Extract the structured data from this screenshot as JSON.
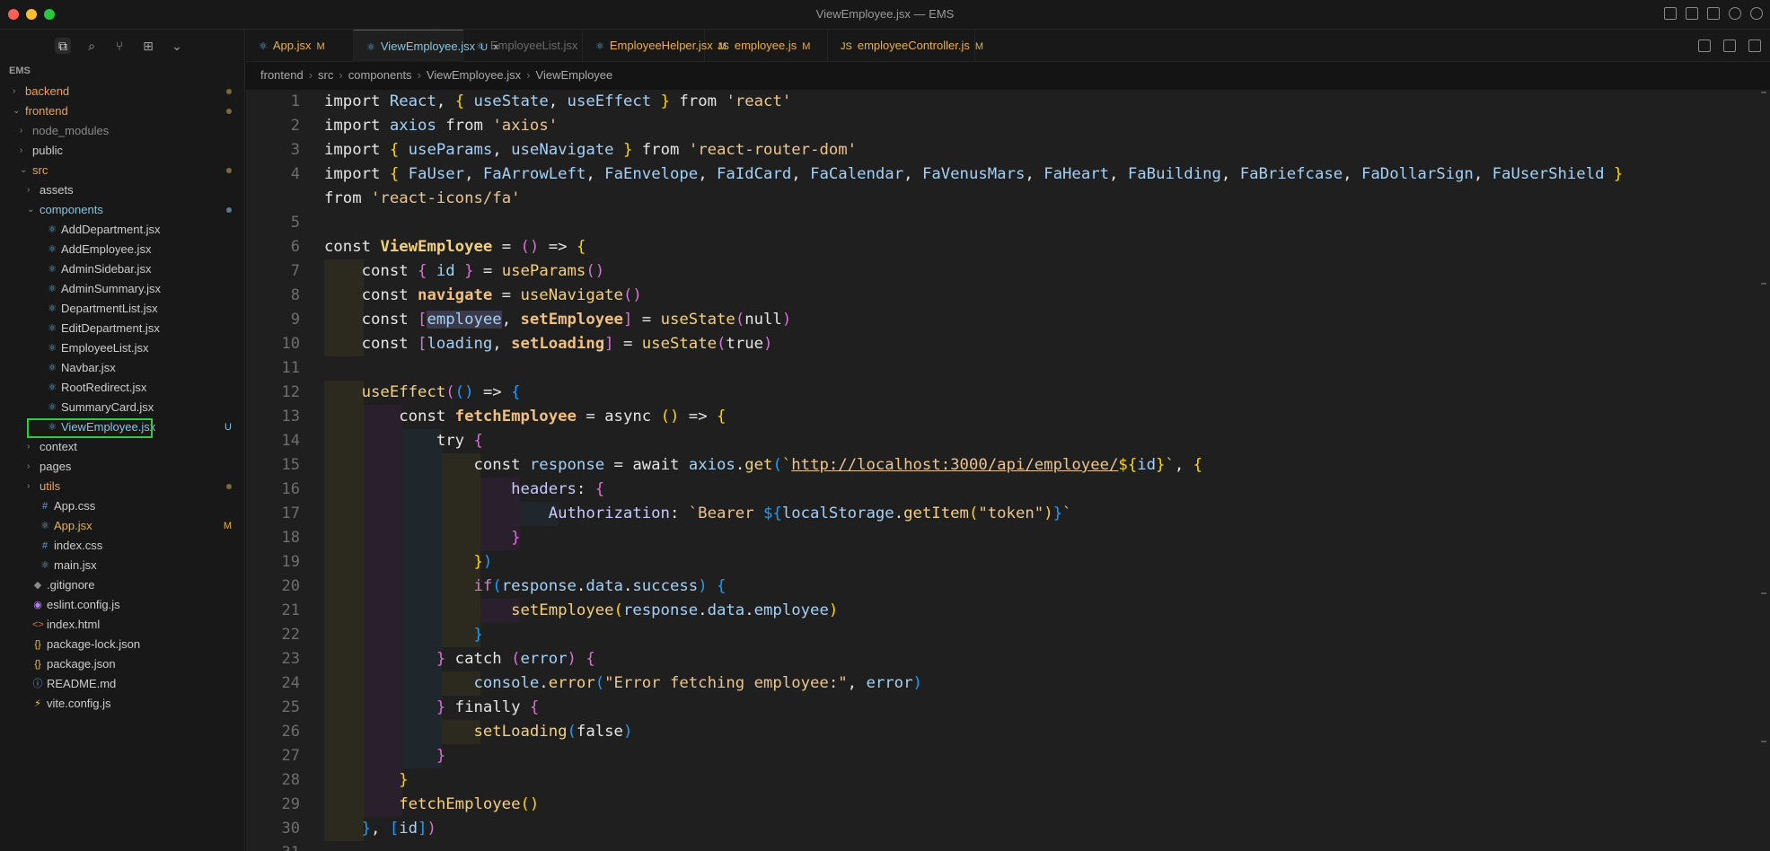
{
  "window": {
    "title": "ViewEmployee.jsx — EMS"
  },
  "sidebar": {
    "project_label": "EMS",
    "tree": [
      {
        "name": "backend",
        "type": "folder",
        "depth": 0,
        "open": false,
        "color": "#f0a050",
        "dot": true
      },
      {
        "name": "frontend",
        "type": "folder",
        "depth": 0,
        "open": true,
        "color": "#f0a050",
        "dot": true
      },
      {
        "name": "node_modules",
        "type": "folder",
        "depth": 1,
        "open": false,
        "color": "#8a8a8a"
      },
      {
        "name": "public",
        "type": "folder",
        "depth": 1,
        "open": false,
        "color": "#cccccc"
      },
      {
        "name": "src",
        "type": "folder",
        "depth": 1,
        "open": true,
        "color": "#f0a050",
        "dot": true
      },
      {
        "name": "assets",
        "type": "folder",
        "depth": 2,
        "open": false,
        "color": "#cccccc"
      },
      {
        "name": "components",
        "type": "folder",
        "depth": 2,
        "open": true,
        "color": "#7ec8e3",
        "dot": true,
        "dot_blue": true
      },
      {
        "name": "AddDepartment.jsx",
        "type": "react",
        "depth": 3,
        "color": "#cccccc"
      },
      {
        "name": "AddEmployee.jsx",
        "type": "react",
        "depth": 3,
        "color": "#cccccc"
      },
      {
        "name": "AdminSidebar.jsx",
        "type": "react",
        "depth": 3,
        "color": "#cccccc"
      },
      {
        "name": "AdminSummary.jsx",
        "type": "react",
        "depth": 3,
        "color": "#cccccc"
      },
      {
        "name": "DepartmentList.jsx",
        "type": "react",
        "depth": 3,
        "color": "#cccccc"
      },
      {
        "name": "EditDepartment.jsx",
        "type": "react",
        "depth": 3,
        "color": "#cccccc"
      },
      {
        "name": "EmployeeList.jsx",
        "type": "react",
        "depth": 3,
        "color": "#cccccc"
      },
      {
        "name": "Navbar.jsx",
        "type": "react",
        "depth": 3,
        "color": "#cccccc"
      },
      {
        "name": "RootRedirect.jsx",
        "type": "react",
        "depth": 3,
        "color": "#cccccc"
      },
      {
        "name": "SummaryCard.jsx",
        "type": "react",
        "depth": 3,
        "color": "#cccccc"
      },
      {
        "name": "ViewEmployee.jsx",
        "type": "react",
        "depth": 3,
        "color": "#7ec8e3",
        "badge": "U",
        "selected": true
      },
      {
        "name": "context",
        "type": "folder",
        "depth": 2,
        "open": false,
        "color": "#cccccc"
      },
      {
        "name": "pages",
        "type": "folder",
        "depth": 2,
        "open": false,
        "color": "#cccccc"
      },
      {
        "name": "utils",
        "type": "folder",
        "depth": 2,
        "open": false,
        "color": "#f0a050",
        "dot": true
      },
      {
        "name": "App.css",
        "type": "css",
        "depth": 2,
        "color": "#cccccc"
      },
      {
        "name": "App.jsx",
        "type": "react",
        "depth": 2,
        "color": "#e8b04a",
        "badge": "M"
      },
      {
        "name": "index.css",
        "type": "css",
        "depth": 2,
        "color": "#cccccc"
      },
      {
        "name": "main.jsx",
        "type": "react",
        "depth": 2,
        "color": "#cccccc"
      },
      {
        "name": ".gitignore",
        "type": "git",
        "depth": 1,
        "color": "#cccccc"
      },
      {
        "name": "eslint.config.js",
        "type": "eslint",
        "depth": 1,
        "color": "#cccccc"
      },
      {
        "name": "index.html",
        "type": "html",
        "depth": 1,
        "color": "#cccccc"
      },
      {
        "name": "package-lock.json",
        "type": "json",
        "depth": 1,
        "color": "#cccccc"
      },
      {
        "name": "package.json",
        "type": "json",
        "depth": 1,
        "color": "#cccccc"
      },
      {
        "name": "README.md",
        "type": "md",
        "depth": 1,
        "color": "#cccccc"
      },
      {
        "name": "vite.config.js",
        "type": "vite",
        "depth": 1,
        "color": "#cccccc"
      }
    ]
  },
  "tabs": [
    {
      "label": "App.jsx",
      "mark": "M",
      "type": "react",
      "color": "#e8b04a"
    },
    {
      "label": "ViewEmployee.jsx",
      "mark": "U",
      "type": "react",
      "color": "#7ec8e3",
      "active": true,
      "close": "×"
    },
    {
      "label": "EmployeeList.jsx",
      "mark": "",
      "type": "react",
      "color": "#6a6a6a"
    },
    {
      "label": "EmployeeHelper.jsx",
      "mark": "M",
      "type": "react",
      "color": "#e8b04a"
    },
    {
      "label": "employee.js",
      "mark": "M",
      "type": "js",
      "color": "#e8b04a"
    },
    {
      "label": "employeeController.js",
      "mark": "M",
      "type": "js",
      "color": "#e8b04a"
    }
  ],
  "breadcrumb": [
    "frontend",
    "src",
    "components",
    "ViewEmployee.jsx",
    "ViewEmployee"
  ],
  "editor": {
    "line_numbers": [
      "1",
      "2",
      "3",
      "4",
      "",
      "5",
      "6",
      "7",
      "8",
      "9",
      "10",
      "11",
      "12",
      "13",
      "14",
      "15",
      "16",
      "17",
      "18",
      "19",
      "20",
      "21",
      "22",
      "23",
      "24",
      "25",
      "26",
      "27",
      "28",
      "29",
      "30",
      "31"
    ],
    "lines": [
      [
        [
          "import ",
          "kw"
        ],
        [
          "React",
          "var"
        ],
        [
          ", ",
          "op"
        ],
        [
          "{",
          "br1"
        ],
        [
          " useState",
          "var"
        ],
        [
          ", ",
          "op"
        ],
        [
          "useEffect",
          "var"
        ],
        [
          " }",
          "br1"
        ],
        [
          " from ",
          "kw"
        ],
        [
          "'react'",
          "str"
        ]
      ],
      [
        [
          "import ",
          "kw"
        ],
        [
          "axios",
          "var"
        ],
        [
          " from ",
          "kw"
        ],
        [
          "'axios'",
          "str"
        ]
      ],
      [
        [
          "import ",
          "kw"
        ],
        [
          "{",
          "br1"
        ],
        [
          " useParams",
          "var"
        ],
        [
          ", ",
          "op"
        ],
        [
          "useNavigate",
          "var"
        ],
        [
          " }",
          "br1"
        ],
        [
          " from ",
          "kw"
        ],
        [
          "'react-router-dom'",
          "str"
        ]
      ],
      [
        [
          "import ",
          "kw"
        ],
        [
          "{",
          "br1"
        ],
        [
          " FaUser",
          "var"
        ],
        [
          ", ",
          "op"
        ],
        [
          "FaArrowLeft",
          "var"
        ],
        [
          ", ",
          "op"
        ],
        [
          "FaEnvelope",
          "var"
        ],
        [
          ", ",
          "op"
        ],
        [
          "FaIdCard",
          "var"
        ],
        [
          ", ",
          "op"
        ],
        [
          "FaCalendar",
          "var"
        ],
        [
          ", ",
          "op"
        ],
        [
          "FaVenusMars",
          "var"
        ],
        [
          ", ",
          "op"
        ],
        [
          "FaHeart",
          "var"
        ],
        [
          ", ",
          "op"
        ],
        [
          "FaBuilding",
          "var"
        ],
        [
          ", ",
          "op"
        ],
        [
          "FaBriefcase",
          "var"
        ],
        [
          ", ",
          "op"
        ],
        [
          "FaDollarSign",
          "var"
        ],
        [
          ", ",
          "op"
        ],
        [
          "FaUserShield",
          "var"
        ],
        [
          " }",
          "br1"
        ]
      ],
      [
        [
          "from ",
          "kw"
        ],
        [
          "'react-icons/fa'",
          "str"
        ]
      ],
      [],
      [
        [
          "const ",
          "kw"
        ],
        [
          "ViewEmployee",
          "fnb"
        ],
        [
          " = ",
          "op"
        ],
        [
          "()",
          "br2"
        ],
        [
          " => ",
          "op"
        ],
        [
          "{",
          "br1"
        ]
      ],
      [
        [
          "    const ",
          "kw"
        ],
        [
          "{",
          "br2"
        ],
        [
          " id ",
          "var"
        ],
        [
          "}",
          "br2"
        ],
        [
          " = ",
          "op"
        ],
        [
          "useParams",
          "fn"
        ],
        [
          "()",
          "br2"
        ]
      ],
      [
        [
          "    const ",
          "kw"
        ],
        [
          "navigate",
          "boldw"
        ],
        [
          " = ",
          "op"
        ],
        [
          "useNavigate",
          "fn"
        ],
        [
          "()",
          "br2"
        ]
      ],
      [
        [
          "    const ",
          "kw"
        ],
        [
          "[",
          "br2"
        ],
        [
          "employee",
          "hlvar"
        ],
        [
          ", ",
          "op"
        ],
        [
          "setEmployee",
          "boldw"
        ],
        [
          "]",
          "br2"
        ],
        [
          " = ",
          "op"
        ],
        [
          "useState",
          "fn"
        ],
        [
          "(",
          "br2"
        ],
        [
          "null",
          "kw"
        ],
        [
          ")",
          "br2"
        ]
      ],
      [
        [
          "    const ",
          "kw"
        ],
        [
          "[",
          "br2"
        ],
        [
          "loading",
          "var"
        ],
        [
          ", ",
          "op"
        ],
        [
          "setLoading",
          "boldw"
        ],
        [
          "]",
          "br2"
        ],
        [
          " = ",
          "op"
        ],
        [
          "useState",
          "fn"
        ],
        [
          "(",
          "br2"
        ],
        [
          "true",
          "kw"
        ],
        [
          ")",
          "br2"
        ]
      ],
      [],
      [
        [
          "    useEffect",
          "fn"
        ],
        [
          "(",
          "br2"
        ],
        [
          "()",
          "br3"
        ],
        [
          " => ",
          "op"
        ],
        [
          "{",
          "br3"
        ]
      ],
      [
        [
          "        const ",
          "kw"
        ],
        [
          "fetchEmployee",
          "boldw"
        ],
        [
          " = ",
          "op"
        ],
        [
          "async ",
          "kw"
        ],
        [
          "()",
          "br1"
        ],
        [
          " => ",
          "op"
        ],
        [
          "{",
          "br1"
        ]
      ],
      [
        [
          "            try ",
          "kw"
        ],
        [
          "{",
          "br2"
        ]
      ],
      [
        [
          "                const ",
          "kw"
        ],
        [
          "response",
          "var"
        ],
        [
          " = ",
          "op"
        ],
        [
          "await ",
          "kw"
        ],
        [
          "axios",
          "var"
        ],
        [
          ".",
          "op"
        ],
        [
          "get",
          "fn"
        ],
        [
          "(",
          "br3"
        ],
        [
          "`",
          "str"
        ],
        [
          "http://localhost:3000/api/employee/",
          "url"
        ],
        [
          "${",
          "br1"
        ],
        [
          "id",
          "var"
        ],
        [
          "}",
          "br1"
        ],
        [
          "`",
          "str"
        ],
        [
          ", ",
          "op"
        ],
        [
          "{",
          "br1"
        ]
      ],
      [
        [
          "                    headers",
          "prop"
        ],
        [
          ": ",
          "op"
        ],
        [
          "{",
          "br2"
        ]
      ],
      [
        [
          "                        Authorization",
          "prop"
        ],
        [
          ": ",
          "op"
        ],
        [
          "`Bearer ",
          "str"
        ],
        [
          "${",
          "br3"
        ],
        [
          "localStorage",
          "var"
        ],
        [
          ".",
          "op"
        ],
        [
          "getItem",
          "fn"
        ],
        [
          "(",
          "br1"
        ],
        [
          "\"token\"",
          "str"
        ],
        [
          ")",
          "br1"
        ],
        [
          "}",
          "br3"
        ],
        [
          "`",
          "str"
        ]
      ],
      [
        [
          "                    }",
          "br2"
        ]
      ],
      [
        [
          "                }",
          "br1"
        ],
        [
          ")",
          "br3"
        ]
      ],
      [
        [
          "                if",
          "kwp"
        ],
        [
          "(",
          "br3"
        ],
        [
          "response",
          "var"
        ],
        [
          ".",
          "op"
        ],
        [
          "data",
          "var"
        ],
        [
          ".",
          "op"
        ],
        [
          "success",
          "var"
        ],
        [
          ")",
          "br3"
        ],
        [
          " {",
          "br3"
        ]
      ],
      [
        [
          "                    setEmployee",
          "fn"
        ],
        [
          "(",
          "br1"
        ],
        [
          "response",
          "var"
        ],
        [
          ".",
          "op"
        ],
        [
          "data",
          "var"
        ],
        [
          ".",
          "op"
        ],
        [
          "employee",
          "var"
        ],
        [
          ")",
          "br1"
        ]
      ],
      [
        [
          "                }",
          "br3"
        ]
      ],
      [
        [
          "            }",
          "br2"
        ],
        [
          " catch ",
          "kw"
        ],
        [
          "(",
          "br2"
        ],
        [
          "error",
          "var"
        ],
        [
          ")",
          "br2"
        ],
        [
          " {",
          "br2"
        ]
      ],
      [
        [
          "                console",
          "var"
        ],
        [
          ".",
          "op"
        ],
        [
          "error",
          "fn"
        ],
        [
          "(",
          "br3"
        ],
        [
          "\"Error fetching employee:\"",
          "str"
        ],
        [
          ", ",
          "op"
        ],
        [
          "error",
          "var"
        ],
        [
          ")",
          "br3"
        ]
      ],
      [
        [
          "            }",
          "br2"
        ],
        [
          " finally ",
          "kw"
        ],
        [
          "{",
          "br2"
        ]
      ],
      [
        [
          "                setLoading",
          "fn"
        ],
        [
          "(",
          "br3"
        ],
        [
          "false",
          "kw"
        ],
        [
          ")",
          "br3"
        ]
      ],
      [
        [
          "            }",
          "br2"
        ]
      ],
      [
        [
          "        }",
          "br1"
        ]
      ],
      [
        [
          "        fetchEmployee",
          "fn"
        ],
        [
          "()",
          "br1"
        ]
      ],
      [
        [
          "    }",
          "br3"
        ],
        [
          ", ",
          "op"
        ],
        [
          "[",
          "br3"
        ],
        [
          "id",
          "var"
        ],
        [
          "]",
          "br3"
        ],
        [
          ")",
          "br2"
        ]
      ],
      []
    ]
  }
}
